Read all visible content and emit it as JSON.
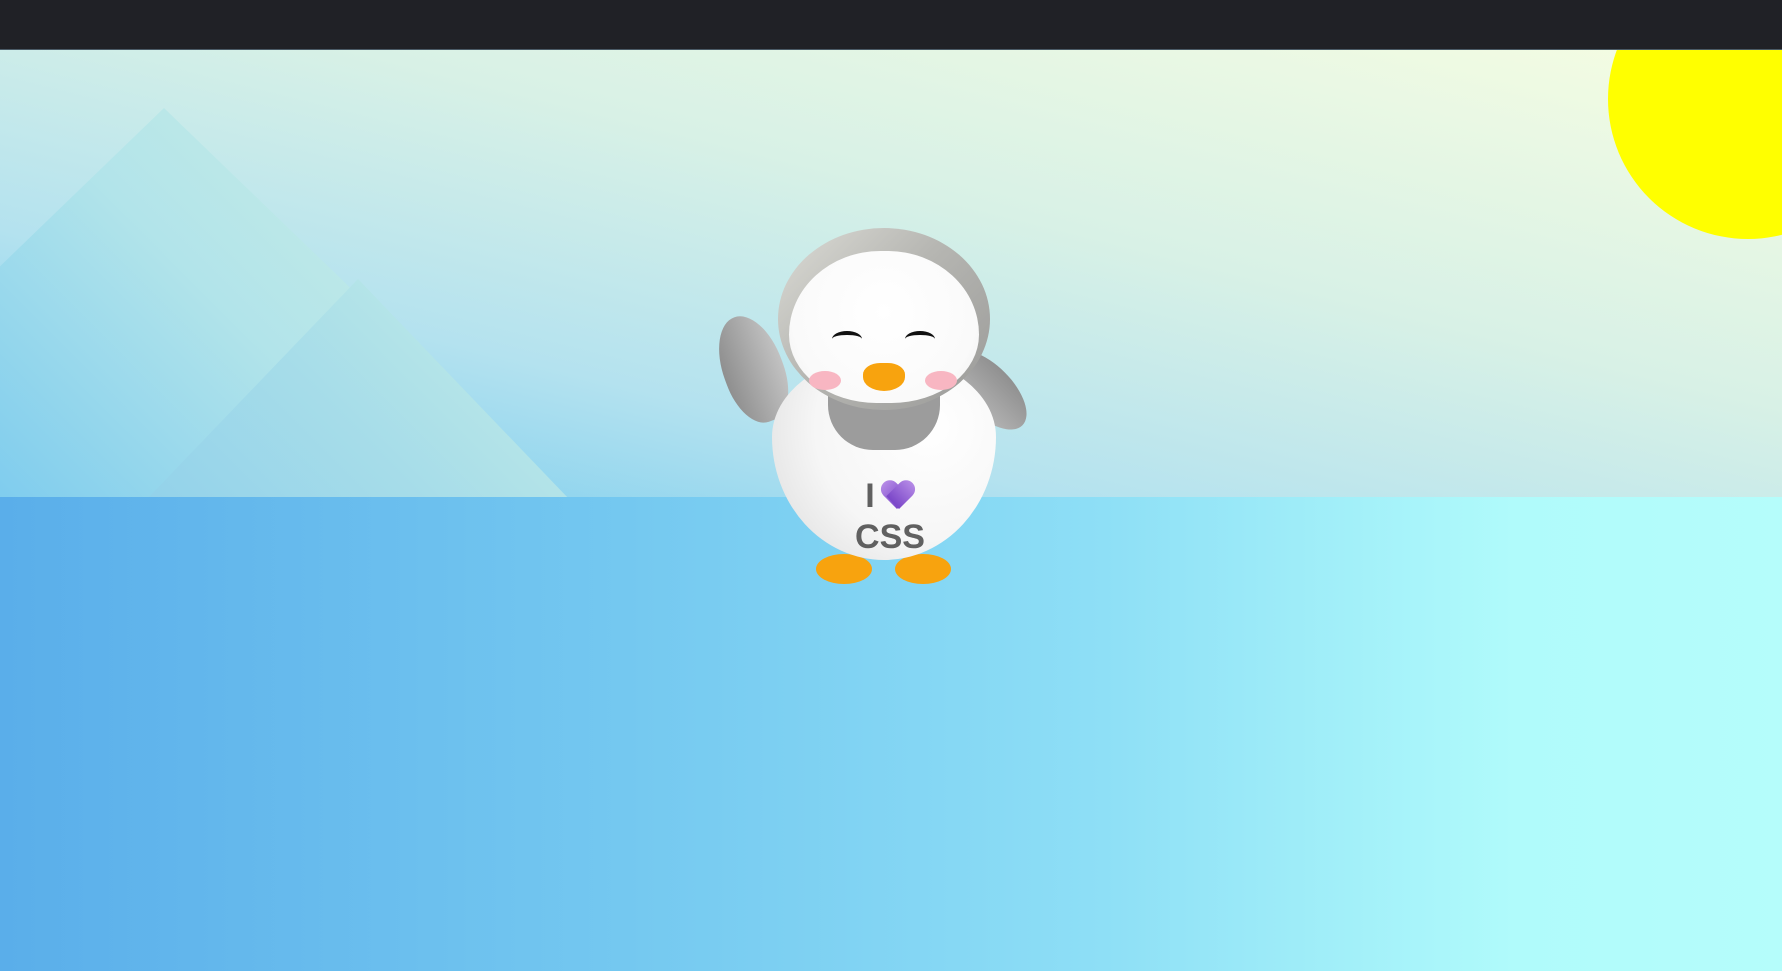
{
  "colors": {
    "topbar": "#202126",
    "sun": "#ffff00",
    "ground_left": "#5aaeea",
    "ground_right": "#b5fdfb",
    "beak_feet": "#f8a30e",
    "cheeks": "#f8b6c2",
    "shirt_text": "#606060",
    "heart": "#8a56d6"
  },
  "penguin": {
    "shirt": {
      "line1": "I",
      "heart_icon": "purple-heart-icon",
      "line2": "CSS"
    }
  }
}
